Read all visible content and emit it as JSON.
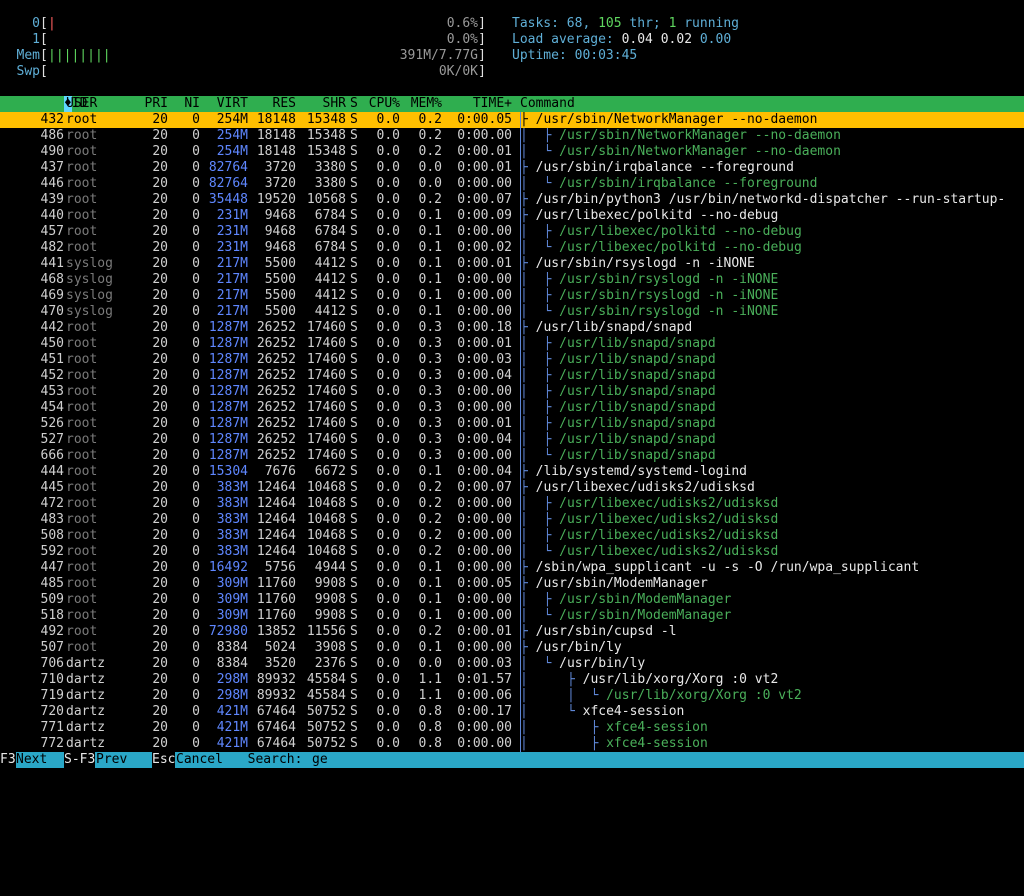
{
  "meters": {
    "cpu0": {
      "label": "0",
      "bars": "|",
      "value": "0.6%"
    },
    "cpu1": {
      "label": "1",
      "bars": "",
      "value": "0.0%"
    },
    "mem": {
      "label": "Mem",
      "bars": "||||||||",
      "value": "391M/7.77G"
    },
    "swp": {
      "label": "Swp",
      "bars": "",
      "value": "0K/0K"
    }
  },
  "system": {
    "tasks_label": "Tasks: ",
    "tasks": "68",
    "threads": "105",
    "thr_label": " thr; ",
    "running": "1",
    "running_label": " running",
    "load_label": "Load average: ",
    "load1": "0.04",
    "load5": "0.02",
    "load15": "0.00",
    "uptime_label": "Uptime: ",
    "uptime": "00:03:45"
  },
  "columns": {
    "pid": "PID",
    "user": "USER",
    "pri": "PRI",
    "ni": "NI",
    "virt": "VIRT",
    "res": "RES",
    "shr": "SHR",
    "s": "S",
    "cpu": "CPU%",
    "mem": "MEM%",
    "time": "TIME+",
    "command": "Command"
  },
  "processes": [
    {
      "pid": "432",
      "user": "root",
      "pri": "20",
      "ni": "0",
      "virt": "254M",
      "res": "18148",
      "shr": "15348",
      "s": "S",
      "cpu": "0.0",
      "mem": "0.2",
      "time": "0:00.05",
      "tree": "├ ",
      "cmd": "/usr/sbin/NetworkManager --no-daemon",
      "thread": false,
      "selected": true
    },
    {
      "pid": "486",
      "user": "root",
      "pri": "20",
      "ni": "0",
      "virt": "254M",
      "res": "18148",
      "shr": "15348",
      "s": "S",
      "cpu": "0.0",
      "mem": "0.2",
      "time": "0:00.00",
      "tree": "│  ├ ",
      "cmd": "/usr/sbin/NetworkManager --no-daemon",
      "thread": true
    },
    {
      "pid": "490",
      "user": "root",
      "pri": "20",
      "ni": "0",
      "virt": "254M",
      "res": "18148",
      "shr": "15348",
      "s": "S",
      "cpu": "0.0",
      "mem": "0.2",
      "time": "0:00.01",
      "tree": "│  └ ",
      "cmd": "/usr/sbin/NetworkManager --no-daemon",
      "thread": true
    },
    {
      "pid": "437",
      "user": "root",
      "pri": "20",
      "ni": "0",
      "virt": "82764",
      "res": "3720",
      "shr": "3380",
      "s": "S",
      "cpu": "0.0",
      "mem": "0.0",
      "time": "0:00.01",
      "tree": "├ ",
      "cmd": "/usr/sbin/irqbalance --foreground",
      "thread": false
    },
    {
      "pid": "446",
      "user": "root",
      "pri": "20",
      "ni": "0",
      "virt": "82764",
      "res": "3720",
      "shr": "3380",
      "s": "S",
      "cpu": "0.0",
      "mem": "0.0",
      "time": "0:00.00",
      "tree": "│  └ ",
      "cmd": "/usr/sbin/irqbalance --foreground",
      "thread": true
    },
    {
      "pid": "439",
      "user": "root",
      "pri": "20",
      "ni": "0",
      "virt": "35448",
      "res": "19520",
      "shr": "10568",
      "s": "S",
      "cpu": "0.0",
      "mem": "0.2",
      "time": "0:00.07",
      "tree": "├ ",
      "cmd": "/usr/bin/python3 /usr/bin/networkd-dispatcher --run-startup-",
      "thread": false
    },
    {
      "pid": "440",
      "user": "root",
      "pri": "20",
      "ni": "0",
      "virt": "231M",
      "res": "9468",
      "shr": "6784",
      "s": "S",
      "cpu": "0.0",
      "mem": "0.1",
      "time": "0:00.09",
      "tree": "├ ",
      "cmd": "/usr/libexec/polkitd --no-debug",
      "thread": false
    },
    {
      "pid": "457",
      "user": "root",
      "pri": "20",
      "ni": "0",
      "virt": "231M",
      "res": "9468",
      "shr": "6784",
      "s": "S",
      "cpu": "0.0",
      "mem": "0.1",
      "time": "0:00.00",
      "tree": "│  ├ ",
      "cmd": "/usr/libexec/polkitd --no-debug",
      "thread": true
    },
    {
      "pid": "482",
      "user": "root",
      "pri": "20",
      "ni": "0",
      "virt": "231M",
      "res": "9468",
      "shr": "6784",
      "s": "S",
      "cpu": "0.0",
      "mem": "0.1",
      "time": "0:00.02",
      "tree": "│  └ ",
      "cmd": "/usr/libexec/polkitd --no-debug",
      "thread": true
    },
    {
      "pid": "441",
      "user": "syslog",
      "pri": "20",
      "ni": "0",
      "virt": "217M",
      "res": "5500",
      "shr": "4412",
      "s": "S",
      "cpu": "0.0",
      "mem": "0.1",
      "time": "0:00.01",
      "tree": "├ ",
      "cmd": "/usr/sbin/rsyslogd -n -iNONE",
      "thread": false
    },
    {
      "pid": "468",
      "user": "syslog",
      "pri": "20",
      "ni": "0",
      "virt": "217M",
      "res": "5500",
      "shr": "4412",
      "s": "S",
      "cpu": "0.0",
      "mem": "0.1",
      "time": "0:00.00",
      "tree": "│  ├ ",
      "cmd": "/usr/sbin/rsyslogd -n -iNONE",
      "thread": true
    },
    {
      "pid": "469",
      "user": "syslog",
      "pri": "20",
      "ni": "0",
      "virt": "217M",
      "res": "5500",
      "shr": "4412",
      "s": "S",
      "cpu": "0.0",
      "mem": "0.1",
      "time": "0:00.00",
      "tree": "│  ├ ",
      "cmd": "/usr/sbin/rsyslogd -n -iNONE",
      "thread": true
    },
    {
      "pid": "470",
      "user": "syslog",
      "pri": "20",
      "ni": "0",
      "virt": "217M",
      "res": "5500",
      "shr": "4412",
      "s": "S",
      "cpu": "0.0",
      "mem": "0.1",
      "time": "0:00.00",
      "tree": "│  └ ",
      "cmd": "/usr/sbin/rsyslogd -n -iNONE",
      "thread": true
    },
    {
      "pid": "442",
      "user": "root",
      "pri": "20",
      "ni": "0",
      "virt": "1287M",
      "res": "26252",
      "shr": "17460",
      "s": "S",
      "cpu": "0.0",
      "mem": "0.3",
      "time": "0:00.18",
      "tree": "├ ",
      "cmd": "/usr/lib/snapd/snapd",
      "thread": false
    },
    {
      "pid": "450",
      "user": "root",
      "pri": "20",
      "ni": "0",
      "virt": "1287M",
      "res": "26252",
      "shr": "17460",
      "s": "S",
      "cpu": "0.0",
      "mem": "0.3",
      "time": "0:00.01",
      "tree": "│  ├ ",
      "cmd": "/usr/lib/snapd/snapd",
      "thread": true
    },
    {
      "pid": "451",
      "user": "root",
      "pri": "20",
      "ni": "0",
      "virt": "1287M",
      "res": "26252",
      "shr": "17460",
      "s": "S",
      "cpu": "0.0",
      "mem": "0.3",
      "time": "0:00.03",
      "tree": "│  ├ ",
      "cmd": "/usr/lib/snapd/snapd",
      "thread": true
    },
    {
      "pid": "452",
      "user": "root",
      "pri": "20",
      "ni": "0",
      "virt": "1287M",
      "res": "26252",
      "shr": "17460",
      "s": "S",
      "cpu": "0.0",
      "mem": "0.3",
      "time": "0:00.04",
      "tree": "│  ├ ",
      "cmd": "/usr/lib/snapd/snapd",
      "thread": true
    },
    {
      "pid": "453",
      "user": "root",
      "pri": "20",
      "ni": "0",
      "virt": "1287M",
      "res": "26252",
      "shr": "17460",
      "s": "S",
      "cpu": "0.0",
      "mem": "0.3",
      "time": "0:00.00",
      "tree": "│  ├ ",
      "cmd": "/usr/lib/snapd/snapd",
      "thread": true
    },
    {
      "pid": "454",
      "user": "root",
      "pri": "20",
      "ni": "0",
      "virt": "1287M",
      "res": "26252",
      "shr": "17460",
      "s": "S",
      "cpu": "0.0",
      "mem": "0.3",
      "time": "0:00.00",
      "tree": "│  ├ ",
      "cmd": "/usr/lib/snapd/snapd",
      "thread": true
    },
    {
      "pid": "526",
      "user": "root",
      "pri": "20",
      "ni": "0",
      "virt": "1287M",
      "res": "26252",
      "shr": "17460",
      "s": "S",
      "cpu": "0.0",
      "mem": "0.3",
      "time": "0:00.01",
      "tree": "│  ├ ",
      "cmd": "/usr/lib/snapd/snapd",
      "thread": true
    },
    {
      "pid": "527",
      "user": "root",
      "pri": "20",
      "ni": "0",
      "virt": "1287M",
      "res": "26252",
      "shr": "17460",
      "s": "S",
      "cpu": "0.0",
      "mem": "0.3",
      "time": "0:00.04",
      "tree": "│  ├ ",
      "cmd": "/usr/lib/snapd/snapd",
      "thread": true
    },
    {
      "pid": "666",
      "user": "root",
      "pri": "20",
      "ni": "0",
      "virt": "1287M",
      "res": "26252",
      "shr": "17460",
      "s": "S",
      "cpu": "0.0",
      "mem": "0.3",
      "time": "0:00.00",
      "tree": "│  └ ",
      "cmd": "/usr/lib/snapd/snapd",
      "thread": true
    },
    {
      "pid": "444",
      "user": "root",
      "pri": "20",
      "ni": "0",
      "virt": "15304",
      "res": "7676",
      "shr": "6672",
      "s": "S",
      "cpu": "0.0",
      "mem": "0.1",
      "time": "0:00.04",
      "tree": "├ ",
      "cmd": "/lib/systemd/systemd-logind",
      "thread": false
    },
    {
      "pid": "445",
      "user": "root",
      "pri": "20",
      "ni": "0",
      "virt": "383M",
      "res": "12464",
      "shr": "10468",
      "s": "S",
      "cpu": "0.0",
      "mem": "0.2",
      "time": "0:00.07",
      "tree": "├ ",
      "cmd": "/usr/libexec/udisks2/udisksd",
      "thread": false
    },
    {
      "pid": "472",
      "user": "root",
      "pri": "20",
      "ni": "0",
      "virt": "383M",
      "res": "12464",
      "shr": "10468",
      "s": "S",
      "cpu": "0.0",
      "mem": "0.2",
      "time": "0:00.00",
      "tree": "│  ├ ",
      "cmd": "/usr/libexec/udisks2/udisksd",
      "thread": true
    },
    {
      "pid": "483",
      "user": "root",
      "pri": "20",
      "ni": "0",
      "virt": "383M",
      "res": "12464",
      "shr": "10468",
      "s": "S",
      "cpu": "0.0",
      "mem": "0.2",
      "time": "0:00.00",
      "tree": "│  ├ ",
      "cmd": "/usr/libexec/udisks2/udisksd",
      "thread": true
    },
    {
      "pid": "508",
      "user": "root",
      "pri": "20",
      "ni": "0",
      "virt": "383M",
      "res": "12464",
      "shr": "10468",
      "s": "S",
      "cpu": "0.0",
      "mem": "0.2",
      "time": "0:00.00",
      "tree": "│  ├ ",
      "cmd": "/usr/libexec/udisks2/udisksd",
      "thread": true
    },
    {
      "pid": "592",
      "user": "root",
      "pri": "20",
      "ni": "0",
      "virt": "383M",
      "res": "12464",
      "shr": "10468",
      "s": "S",
      "cpu": "0.0",
      "mem": "0.2",
      "time": "0:00.00",
      "tree": "│  └ ",
      "cmd": "/usr/libexec/udisks2/udisksd",
      "thread": true
    },
    {
      "pid": "447",
      "user": "root",
      "pri": "20",
      "ni": "0",
      "virt": "16492",
      "res": "5756",
      "shr": "4944",
      "s": "S",
      "cpu": "0.0",
      "mem": "0.1",
      "time": "0:00.00",
      "tree": "├ ",
      "cmd": "/sbin/wpa_supplicant -u -s -O /run/wpa_supplicant",
      "thread": false
    },
    {
      "pid": "485",
      "user": "root",
      "pri": "20",
      "ni": "0",
      "virt": "309M",
      "res": "11760",
      "shr": "9908",
      "s": "S",
      "cpu": "0.0",
      "mem": "0.1",
      "time": "0:00.05",
      "tree": "├ ",
      "cmd": "/usr/sbin/ModemManager",
      "thread": false
    },
    {
      "pid": "509",
      "user": "root",
      "pri": "20",
      "ni": "0",
      "virt": "309M",
      "res": "11760",
      "shr": "9908",
      "s": "S",
      "cpu": "0.0",
      "mem": "0.1",
      "time": "0:00.00",
      "tree": "│  ├ ",
      "cmd": "/usr/sbin/ModemManager",
      "thread": true
    },
    {
      "pid": "518",
      "user": "root",
      "pri": "20",
      "ni": "0",
      "virt": "309M",
      "res": "11760",
      "shr": "9908",
      "s": "S",
      "cpu": "0.0",
      "mem": "0.1",
      "time": "0:00.00",
      "tree": "│  └ ",
      "cmd": "/usr/sbin/ModemManager",
      "thread": true
    },
    {
      "pid": "492",
      "user": "root",
      "pri": "20",
      "ni": "0",
      "virt": "72980",
      "res": "13852",
      "shr": "11556",
      "s": "S",
      "cpu": "0.0",
      "mem": "0.2",
      "time": "0:00.01",
      "tree": "├ ",
      "cmd": "/usr/sbin/cupsd -l",
      "thread": false
    },
    {
      "pid": "507",
      "user": "root",
      "pri": "20",
      "ni": "0",
      "virt": "8384",
      "res": "5024",
      "shr": "3908",
      "s": "S",
      "cpu": "0.0",
      "mem": "0.1",
      "time": "0:00.00",
      "tree": "├ ",
      "cmd": "/usr/bin/ly",
      "thread": false
    },
    {
      "pid": "706",
      "user": "dartz",
      "pri": "20",
      "ni": "0",
      "virt": "8384",
      "res": "3520",
      "shr": "2376",
      "s": "S",
      "cpu": "0.0",
      "mem": "0.0",
      "time": "0:00.03",
      "tree": "│  └ ",
      "cmd": "/usr/bin/ly",
      "thread": false
    },
    {
      "pid": "710",
      "user": "dartz",
      "pri": "20",
      "ni": "0",
      "virt": "298M",
      "res": "89932",
      "shr": "45584",
      "s": "S",
      "cpu": "0.0",
      "mem": "1.1",
      "time": "0:01.57",
      "tree": "│     ├ ",
      "cmd": "/usr/lib/xorg/Xorg :0 vt2",
      "thread": false
    },
    {
      "pid": "719",
      "user": "dartz",
      "pri": "20",
      "ni": "0",
      "virt": "298M",
      "res": "89932",
      "shr": "45584",
      "s": "S",
      "cpu": "0.0",
      "mem": "1.1",
      "time": "0:00.06",
      "tree": "│     │  └ ",
      "cmd": "/usr/lib/xorg/Xorg :0 vt2",
      "thread": true
    },
    {
      "pid": "720",
      "user": "dartz",
      "pri": "20",
      "ni": "0",
      "virt": "421M",
      "res": "67464",
      "shr": "50752",
      "s": "S",
      "cpu": "0.0",
      "mem": "0.8",
      "time": "0:00.17",
      "tree": "│     └ ",
      "cmd": "xfce4-session",
      "thread": false
    },
    {
      "pid": "771",
      "user": "dartz",
      "pri": "20",
      "ni": "0",
      "virt": "421M",
      "res": "67464",
      "shr": "50752",
      "s": "S",
      "cpu": "0.0",
      "mem": "0.8",
      "time": "0:00.00",
      "tree": "│        ├ ",
      "cmd": "xfce4-session",
      "thread": true
    },
    {
      "pid": "772",
      "user": "dartz",
      "pri": "20",
      "ni": "0",
      "virt": "421M",
      "res": "67464",
      "shr": "50752",
      "s": "S",
      "cpu": "0.0",
      "mem": "0.8",
      "time": "0:00.00",
      "tree": "│        ├ ",
      "cmd": "xfce4-session",
      "thread": true
    }
  ],
  "footer": {
    "f3": "F3",
    "next": "Next",
    "sf3": "S-F3",
    "prev": "Prev",
    "esc": "Esc",
    "cancel": "Cancel",
    "search_label": "  Search: ",
    "search_value": "ge"
  },
  "colors": {
    "header_bg": "#2fae4f",
    "selected_bg": "#ffbf00",
    "footer_bg": "#2aa7c7"
  }
}
